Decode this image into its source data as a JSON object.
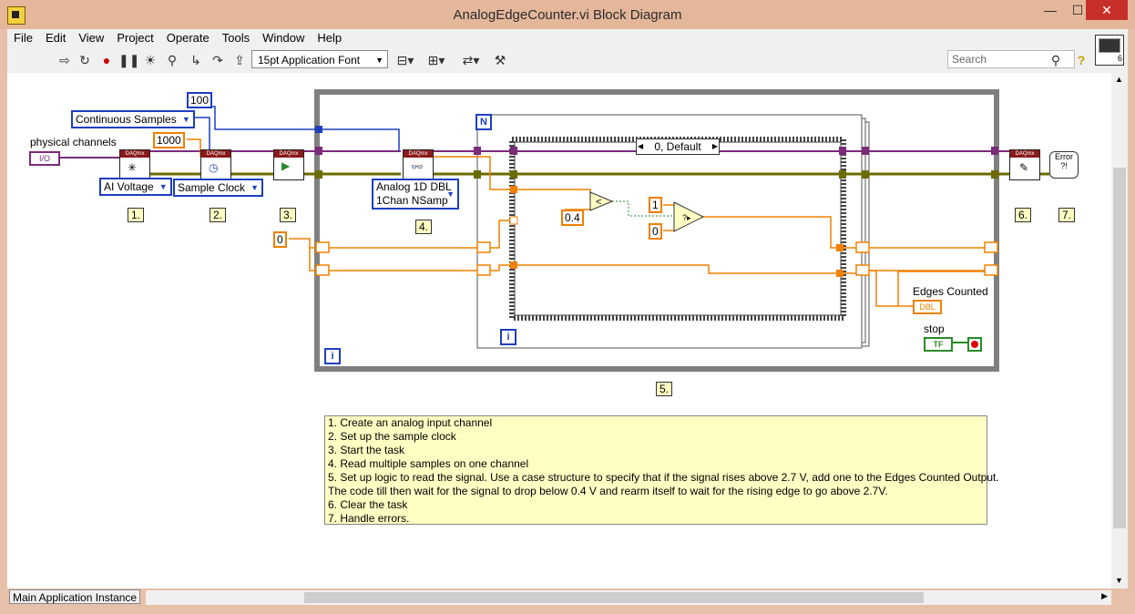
{
  "window": {
    "title": "AnalogEdgeCounter.vi Block Diagram",
    "minimize": "—",
    "maximize": "☐",
    "close": "✕"
  },
  "menu": [
    "File",
    "Edit",
    "View",
    "Project",
    "Operate",
    "Tools",
    "Window",
    "Help"
  ],
  "toolbar": {
    "font": "15pt Application Font",
    "search_placeholder": "Search",
    "help": "?"
  },
  "diagram": {
    "physical_channels_label": "physical channels",
    "io_constant": "I/O",
    "continuous_samples": "Continuous Samples",
    "rate": "1000",
    "samples": "100",
    "ai_voltage": "AI Voltage",
    "sample_clock": "Sample Clock",
    "analog_1d_line1": "Analog 1D DBL",
    "analog_1d_line2": "1Chan NSamp",
    "zero_init": "0",
    "case_selector": "0, Default",
    "threshold_low": "0.4",
    "one_const": "1",
    "zero_const": "0",
    "n_terminal": "N",
    "i_terminal": "i",
    "i_terminal_outer": "i",
    "edges_counted_label": "Edges Counted",
    "edges_counted_type": "DBL",
    "stop_label": "stop",
    "stop_tf": "TF",
    "daqmx": "DAQmx",
    "error_label": "Error",
    "step_labels": [
      "1.",
      "2.",
      "3.",
      "4.",
      "5.",
      "6.",
      "7."
    ]
  },
  "comment_lines": [
    "1. Create an analog input channel",
    "2. Set up the sample clock",
    "3. Start the task",
    "4. Read multiple samples on one channel",
    "5. Set up logic to read the signal.  Use a case structure to specify that if the signal rises above 2.7 V, add one to the Edges Counted Output.",
    "The code till then wait for the signal to drop below 0.4 V and rearm itself to wait for the rising edge to go above 2.7V.",
    "6. Clear the task",
    "7. Handle errors."
  ],
  "status": {
    "instance": "Main Application Instance"
  },
  "colors": {
    "wire_task": "#7b2a7b",
    "wire_error": "#6b6b00",
    "wire_numeric": "#f08000",
    "wire_int": "#1d3fbf",
    "wire_bool": "#2a8a2a",
    "structure": "#808080"
  }
}
